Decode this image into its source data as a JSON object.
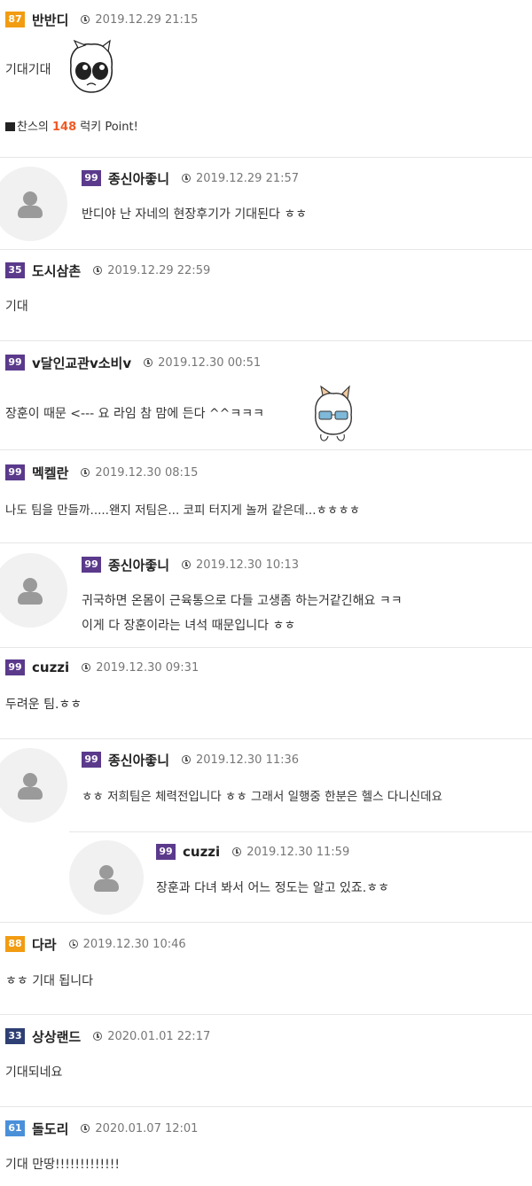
{
  "colors": {
    "orange": "#f29c12",
    "purple": "#5b3a8c",
    "blue": "#4a90d9",
    "navy": "#2e3f73"
  },
  "comments": [
    {
      "level": "87",
      "nick": "반반디",
      "date": "2019.12.29 21:15",
      "text": "기대기대",
      "sticker": "cat-face-sticker",
      "luck_prefix": "찬스의 ",
      "luck_num": "148",
      "luck_suffix": " 럭키 Point!"
    },
    {
      "level": "99",
      "nick": "종신아좋니",
      "date": "2019.12.29 21:57",
      "text": "반디야 난 자네의 현장후기가 기대된다 ㅎㅎ"
    },
    {
      "level": "35",
      "nick": "도시삼촌",
      "date": "2019.12.29 22:59",
      "text": "기대"
    },
    {
      "level": "99",
      "nick": "v달인교관v소비v",
      "date": "2019.12.30 00:51",
      "text": "장훈이 때문 <--- 요 라임 참 맘에 든다 ^^ㅋㅋㅋ",
      "sticker": "cat-sunglasses-sticker"
    },
    {
      "level": "99",
      "nick": "멕켈란",
      "date": "2019.12.30 08:15",
      "text": "나도 팀을 만들까.....왠지 저팀은... 코피 터지게 놀꺼 같은데...ㅎㅎㅎㅎ"
    },
    {
      "level": "99",
      "nick": "종신아좋니",
      "date": "2019.12.30 10:13",
      "text": "귀국하면 온몸이 근육통으로 다들 고생좀 하는거같긴해요 ㅋㅋ",
      "text2": "이게 다 장훈이라는 녀석 때문입니다 ㅎㅎ"
    },
    {
      "level": "99",
      "nick": "cuzzi",
      "date": "2019.12.30 09:31",
      "text": "두려운 팀.ㅎㅎ"
    },
    {
      "level": "99",
      "nick": "종신아좋니",
      "date": "2019.12.30 11:36",
      "text": "ㅎㅎ 저희팀은 체력전입니다 ㅎㅎ 그래서 일행중 한분은 헬스 다니신데요"
    },
    {
      "level": "99",
      "nick": "cuzzi",
      "date": "2019.12.30 11:59",
      "text": "장훈과 다녀 봐서 어느 정도는 알고 있죠.ㅎㅎ"
    },
    {
      "level": "88",
      "nick": "다라",
      "date": "2019.12.30 10:46",
      "text": "ㅎㅎ 기대 됩니다"
    },
    {
      "level": "33",
      "nick": "상상랜드",
      "date": "2020.01.01 22:17",
      "text": "기대되네요"
    },
    {
      "level": "61",
      "nick": "돌도리",
      "date": "2020.01.07 12:01",
      "text": "기대 만땅!!!!!!!!!!!!!"
    }
  ]
}
